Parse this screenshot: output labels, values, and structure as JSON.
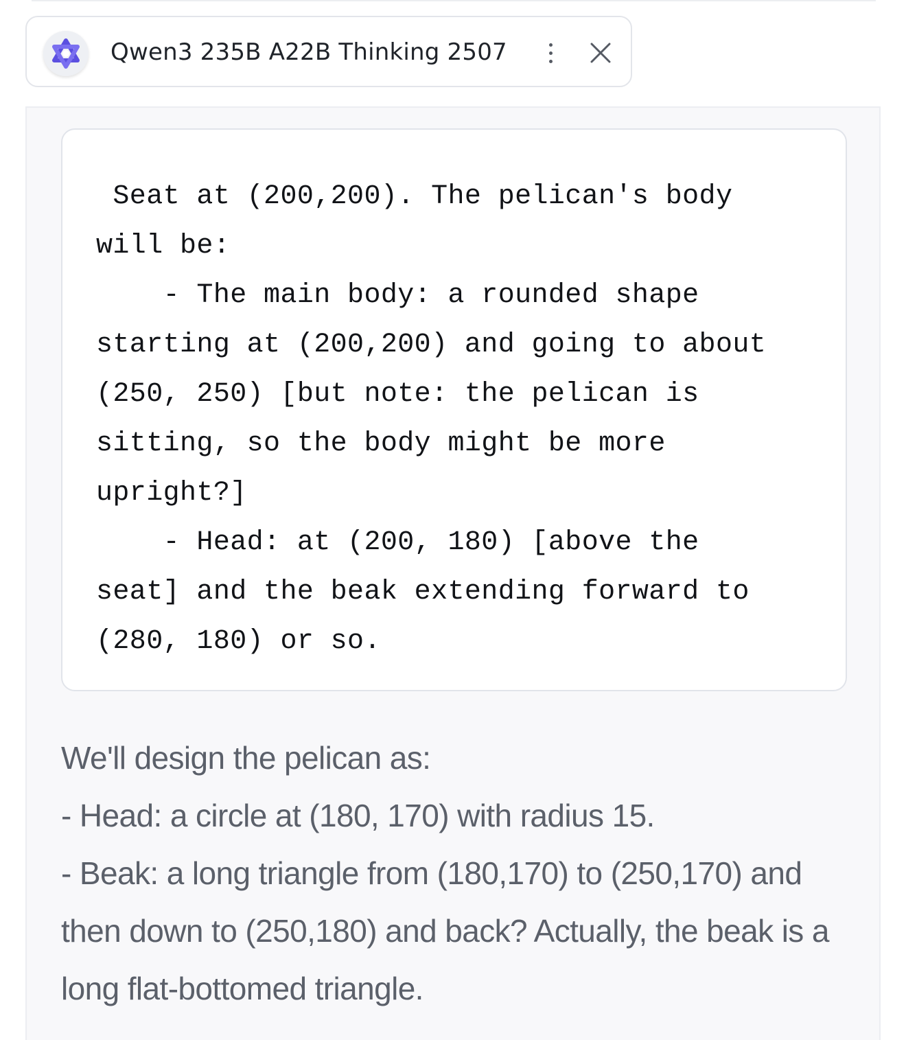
{
  "model_chip": {
    "name": "Qwen3 235B A22B Thinking 2507",
    "avatar_icon": "qwen-logo-icon",
    "menu_icon": "kebab-menu-icon",
    "close_icon": "close-icon",
    "accent_color": "#5b4fe0"
  },
  "code_block": {
    "text": " Seat at (200,200). The pelican's body\nwill be:\n    - The main body: a rounded shape\nstarting at (200,200) and going to about\n(250, 250) [but note: the pelican is\nsitting, so the body might be more\nupright?]\n    - Head: at (200, 180) [above the\nseat] and the beak extending forward to\n(280, 180) or so."
  },
  "prose": {
    "intro": "We'll design the pelican as:",
    "line_head": "- Head: a circle at (180, 170) with radius 15.",
    "line_beak": "- Beak: a long triangle from (180,170) to (250,170) and then down to (250,180) and back? Actually, the beak is a long flat-bottomed triangle."
  }
}
